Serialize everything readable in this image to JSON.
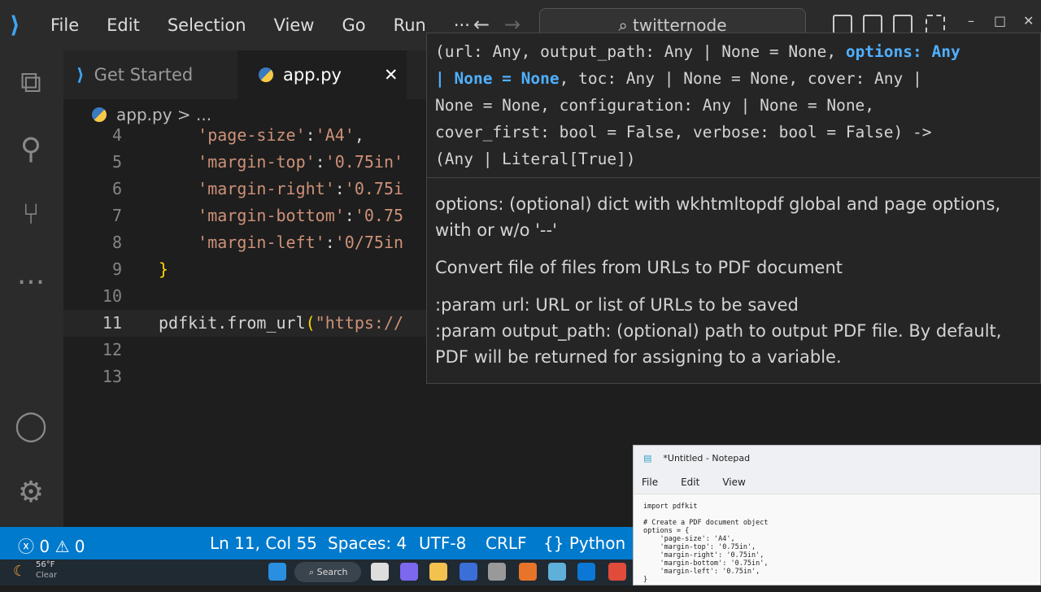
{
  "titlebar": {
    "menus": [
      "File",
      "Edit",
      "Selection",
      "View",
      "Go",
      "Run",
      "···"
    ],
    "search": "twitternode",
    "back": "←",
    "forward": "→",
    "minimize": "–",
    "maximize": "□",
    "close": "✕"
  },
  "tabs": [
    {
      "label": "Get Started",
      "active": false
    },
    {
      "label": "app.py",
      "active": true,
      "close": "✕"
    }
  ],
  "breadcrumb": {
    "file": "app.py",
    "sep": ">",
    "more": "..."
  },
  "editor": {
    "lines": [
      {
        "n": "4",
        "tokens": [
          [
            "    ",
            "def"
          ],
          [
            "'page-size'",
            "str"
          ],
          [
            ":",
            "def"
          ],
          [
            "'A4'",
            "str"
          ],
          [
            ",",
            "def"
          ]
        ]
      },
      {
        "n": "5",
        "tokens": [
          [
            "    ",
            "def"
          ],
          [
            "'margin-top'",
            "str"
          ],
          [
            ":",
            "def"
          ],
          [
            "'0.75in'",
            "str"
          ]
        ]
      },
      {
        "n": "6",
        "tokens": [
          [
            "    ",
            "def"
          ],
          [
            "'margin-right'",
            "str"
          ],
          [
            ":",
            "def"
          ],
          [
            "'0.75i",
            "str"
          ]
        ]
      },
      {
        "n": "7",
        "tokens": [
          [
            "    ",
            "def"
          ],
          [
            "'margin-bottom'",
            "str"
          ],
          [
            ":",
            "def"
          ],
          [
            "'0.75",
            "str"
          ]
        ]
      },
      {
        "n": "8",
        "tokens": [
          [
            "    ",
            "def"
          ],
          [
            "'margin-left'",
            "str"
          ],
          [
            ":",
            "def"
          ],
          [
            "'0/75in",
            "str"
          ]
        ]
      },
      {
        "n": "9",
        "tokens": [
          [
            "}",
            "br"
          ]
        ]
      },
      {
        "n": "10",
        "tokens": []
      },
      {
        "n": "11",
        "tokens": [
          [
            "pdfkit.from_url",
            "def"
          ],
          [
            "(",
            "br"
          ],
          [
            "\"https://",
            "str"
          ]
        ],
        "current": true
      },
      {
        "n": "12",
        "tokens": []
      },
      {
        "n": "13",
        "tokens": []
      }
    ]
  },
  "hover": {
    "signature": [
      [
        [
          "(url: Any, output_path: Any | None = None, ",
          ""
        ],
        [
          "options: Any",
          "hl"
        ]
      ],
      [
        [
          "| None = None",
          "hl"
        ],
        [
          ", toc: Any | None = None, cover: Any |",
          ""
        ]
      ],
      [
        [
          "None = None, configuration: Any | None = None,",
          ""
        ]
      ],
      [
        [
          "cover_first: bool = False, verbose: bool = False) ->",
          ""
        ]
      ],
      [
        [
          "(Any | Literal[True])",
          ""
        ]
      ]
    ],
    "doc": [
      "options: (optional) dict with wkhtmltopdf global and page options, with or w/o '--'",
      "Convert file of files from URLs to PDF document",
      ":param url: URL or list of URLs to be saved",
      ":param output_path: (optional) path to output PDF file. By default, PDF will be returned for assigning to a variable."
    ]
  },
  "status": {
    "errors": "0",
    "warnings": "0",
    "position": "Ln 11, Col 55",
    "spaces": "Spaces: 4",
    "encoding": "UTF-8",
    "eol": "CRLF",
    "language": "Python"
  },
  "taskbar": {
    "temp": "56°F",
    "weather": "Clear",
    "search": "Search",
    "icons": [
      "start-icon",
      "task-view-icon",
      "teams-icon",
      "file-explorer-icon",
      "filezilla-icon",
      "app-icon",
      "xampp-icon",
      "notepad-icon",
      "outlook-icon",
      "chrome-icon"
    ]
  },
  "notepad": {
    "title": "*Untitled - Notepad",
    "menus": [
      "File",
      "Edit",
      "View"
    ],
    "text": "import pdfkit\n\n# Create a PDF document object\noptions = {\n    'page-size': 'A4',\n    'margin-top': '0.75in',\n    'margin-right': '0.75in',\n    'margin-bottom': '0.75in',\n    'margin-left': '0.75in',\n}"
  },
  "colors": {
    "accent": "#007acc",
    "string": "#ce9178",
    "bracket": "#ffd700",
    "highlight": "#4fb0ff"
  }
}
